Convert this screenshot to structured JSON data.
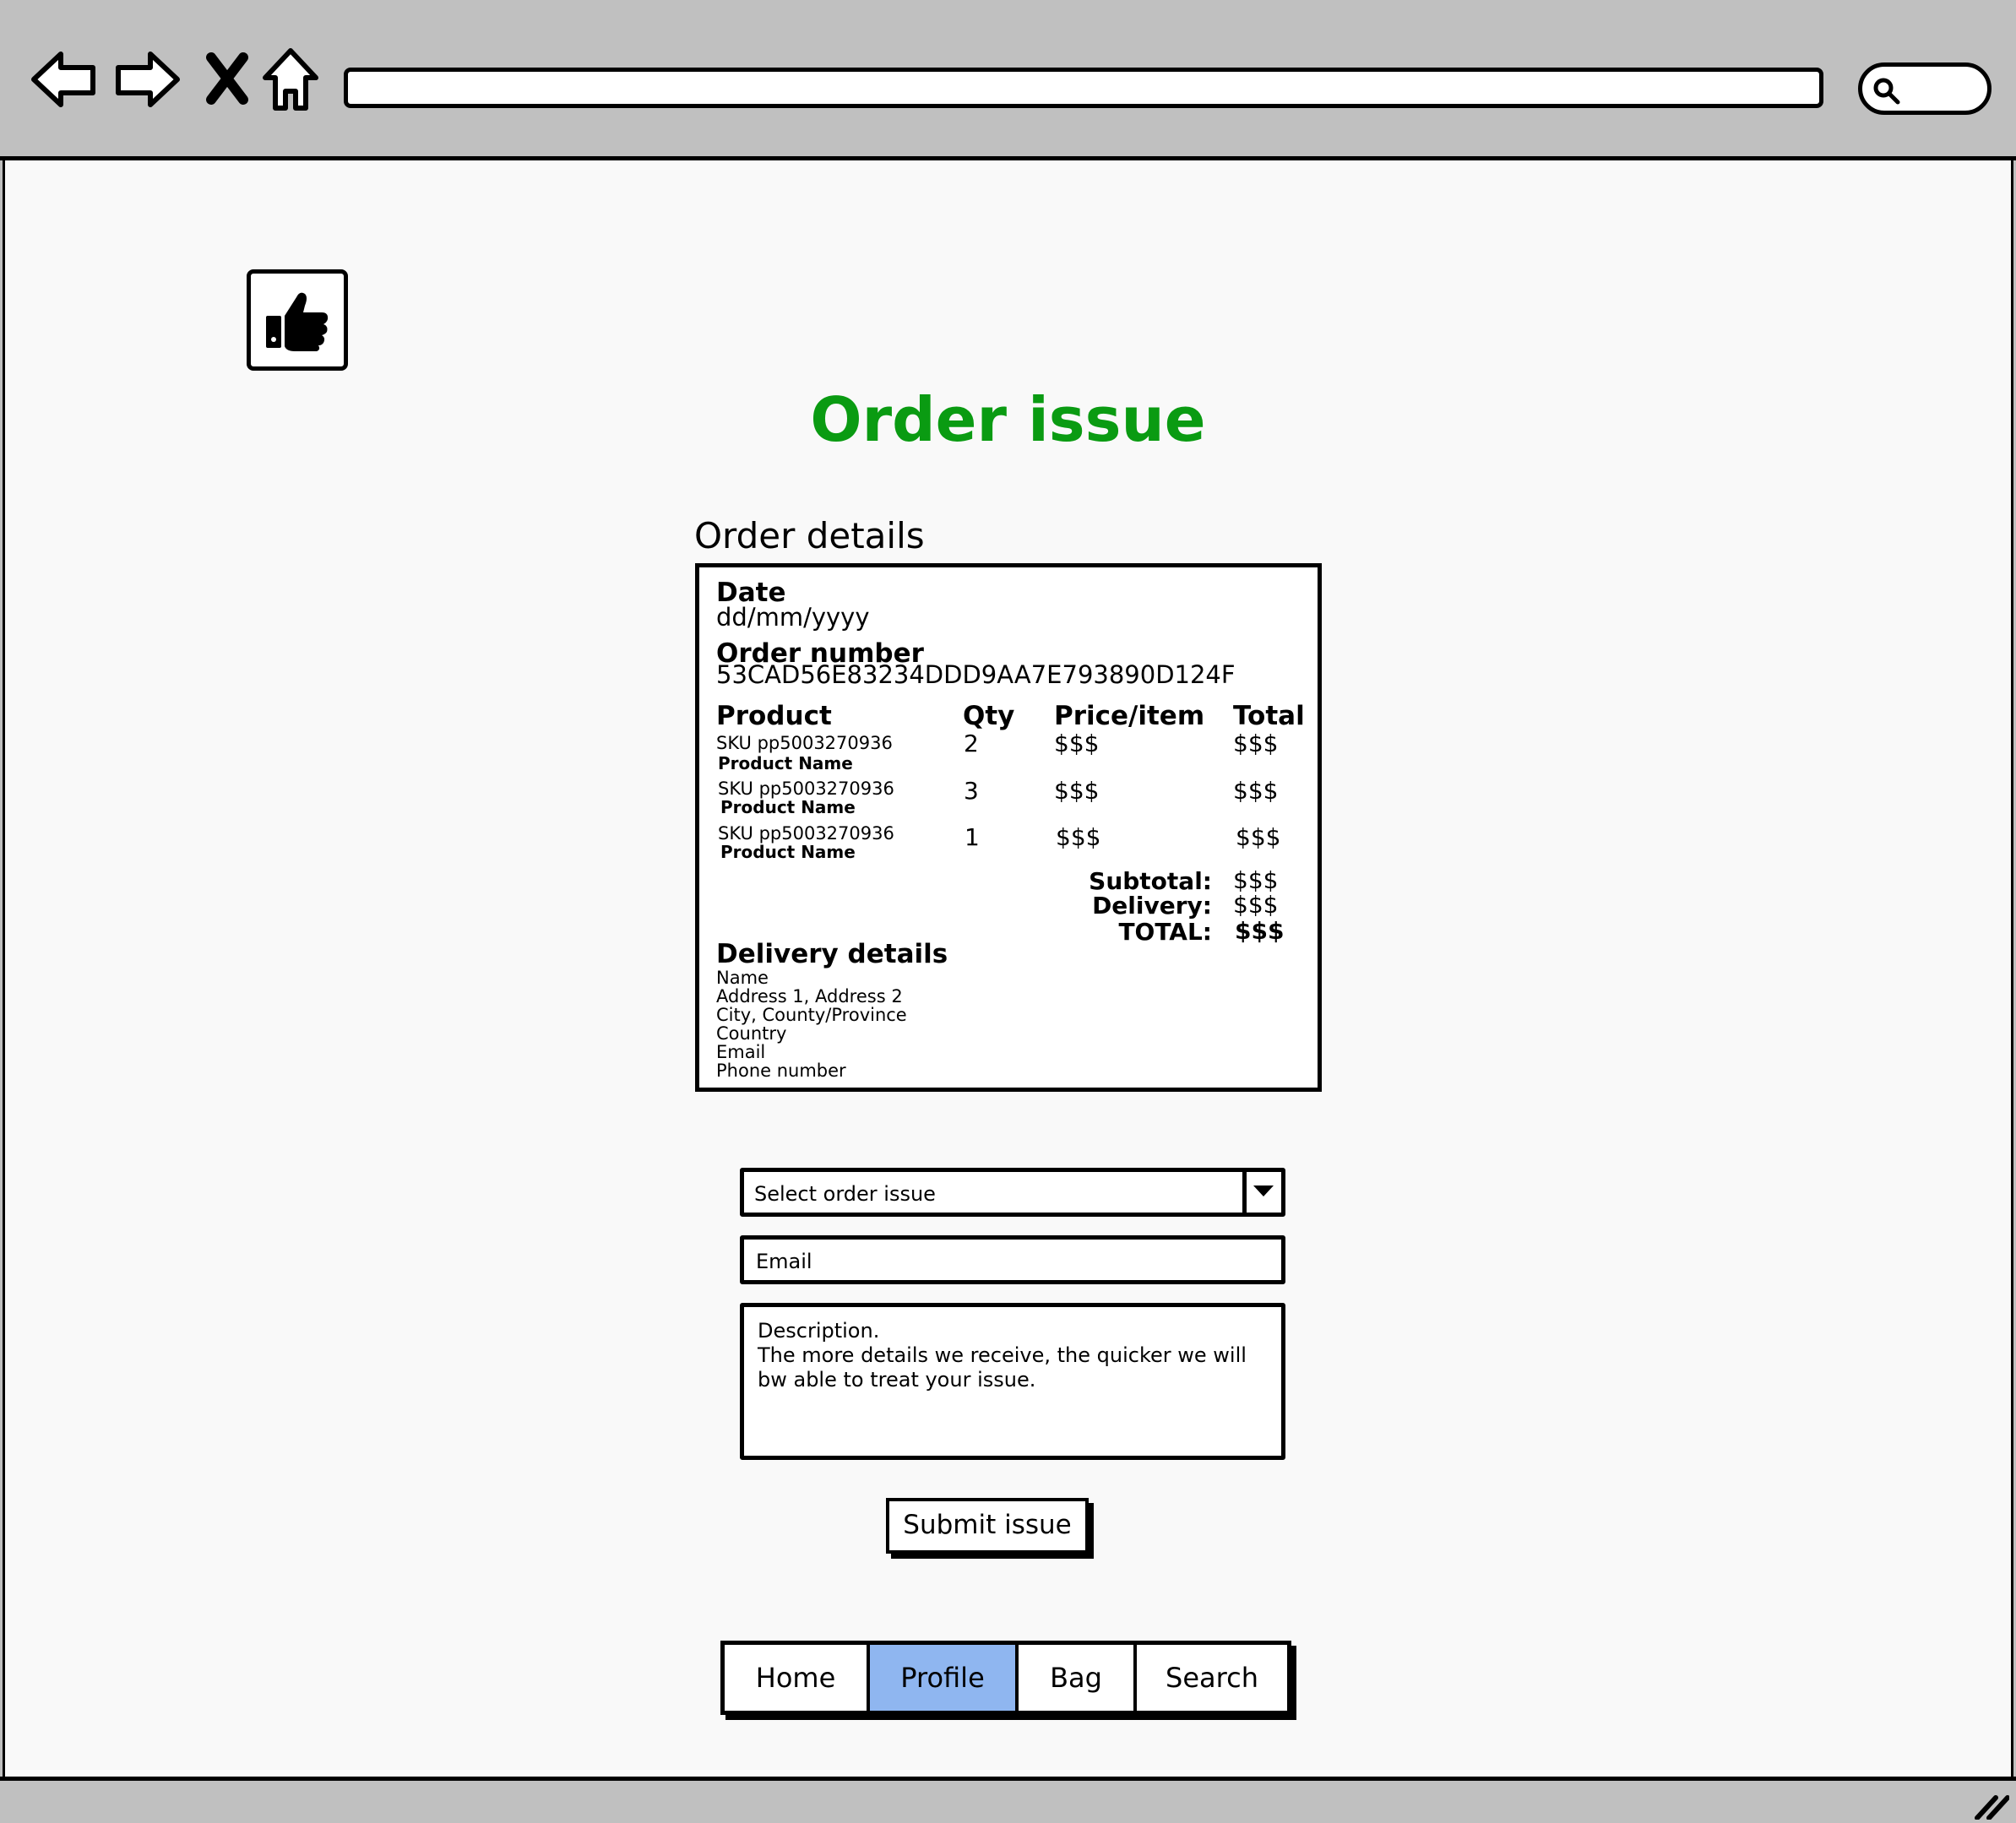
{
  "browser": {
    "icons": {
      "back": "back-arrow-icon",
      "forward": "forward-arrow-icon",
      "stop": "close-icon",
      "home": "home-icon",
      "search": "search-icon"
    }
  },
  "header": {
    "logo_icon": "thumbs-up-icon",
    "title": "Order issue",
    "title_color": "#0a9b12"
  },
  "order": {
    "section_label": "Order details",
    "date_label": "Date",
    "date_value": "dd/mm/yyyy",
    "order_number_label": "Order number",
    "order_number_value": "53CAD56E83234DDD9AA7E793890D124F",
    "columns": [
      "Product",
      "Qty",
      "Price/item",
      "Total"
    ],
    "items": [
      {
        "sku": "SKU pp5003270936",
        "name": "Product Name",
        "qty": "2",
        "price": "$$$",
        "total": "$$$"
      },
      {
        "sku": "SKU pp5003270936",
        "name": "Product Name",
        "qty": "3",
        "price": "$$$",
        "total": "$$$"
      },
      {
        "sku": "SKU pp5003270936",
        "name": "Product Name",
        "qty": "1",
        "price": "$$$",
        "total": "$$$"
      }
    ],
    "subtotal_label": "Subtotal:",
    "subtotal_value": "$$$",
    "delivery_label": "Delivery:",
    "delivery_value": "$$$",
    "total_label": "TOTAL:",
    "total_value": "$$$",
    "delivery_details": {
      "heading": "Delivery details",
      "lines": [
        "Name",
        "Address 1, Address 2",
        "City, County/Province",
        "Country",
        "Email",
        "Phone number"
      ]
    }
  },
  "form": {
    "issue_select": "Select order issue",
    "email_placeholder": "Email",
    "description_placeholder": "Description.\nThe more details we receive, the quicker we will bw able to treat your issue.",
    "submit_label": "Submit issue"
  },
  "nav": {
    "items": [
      "Home",
      "Profile",
      "Bag",
      "Search"
    ],
    "active": "Profile",
    "active_color": "#8fb6f0"
  }
}
